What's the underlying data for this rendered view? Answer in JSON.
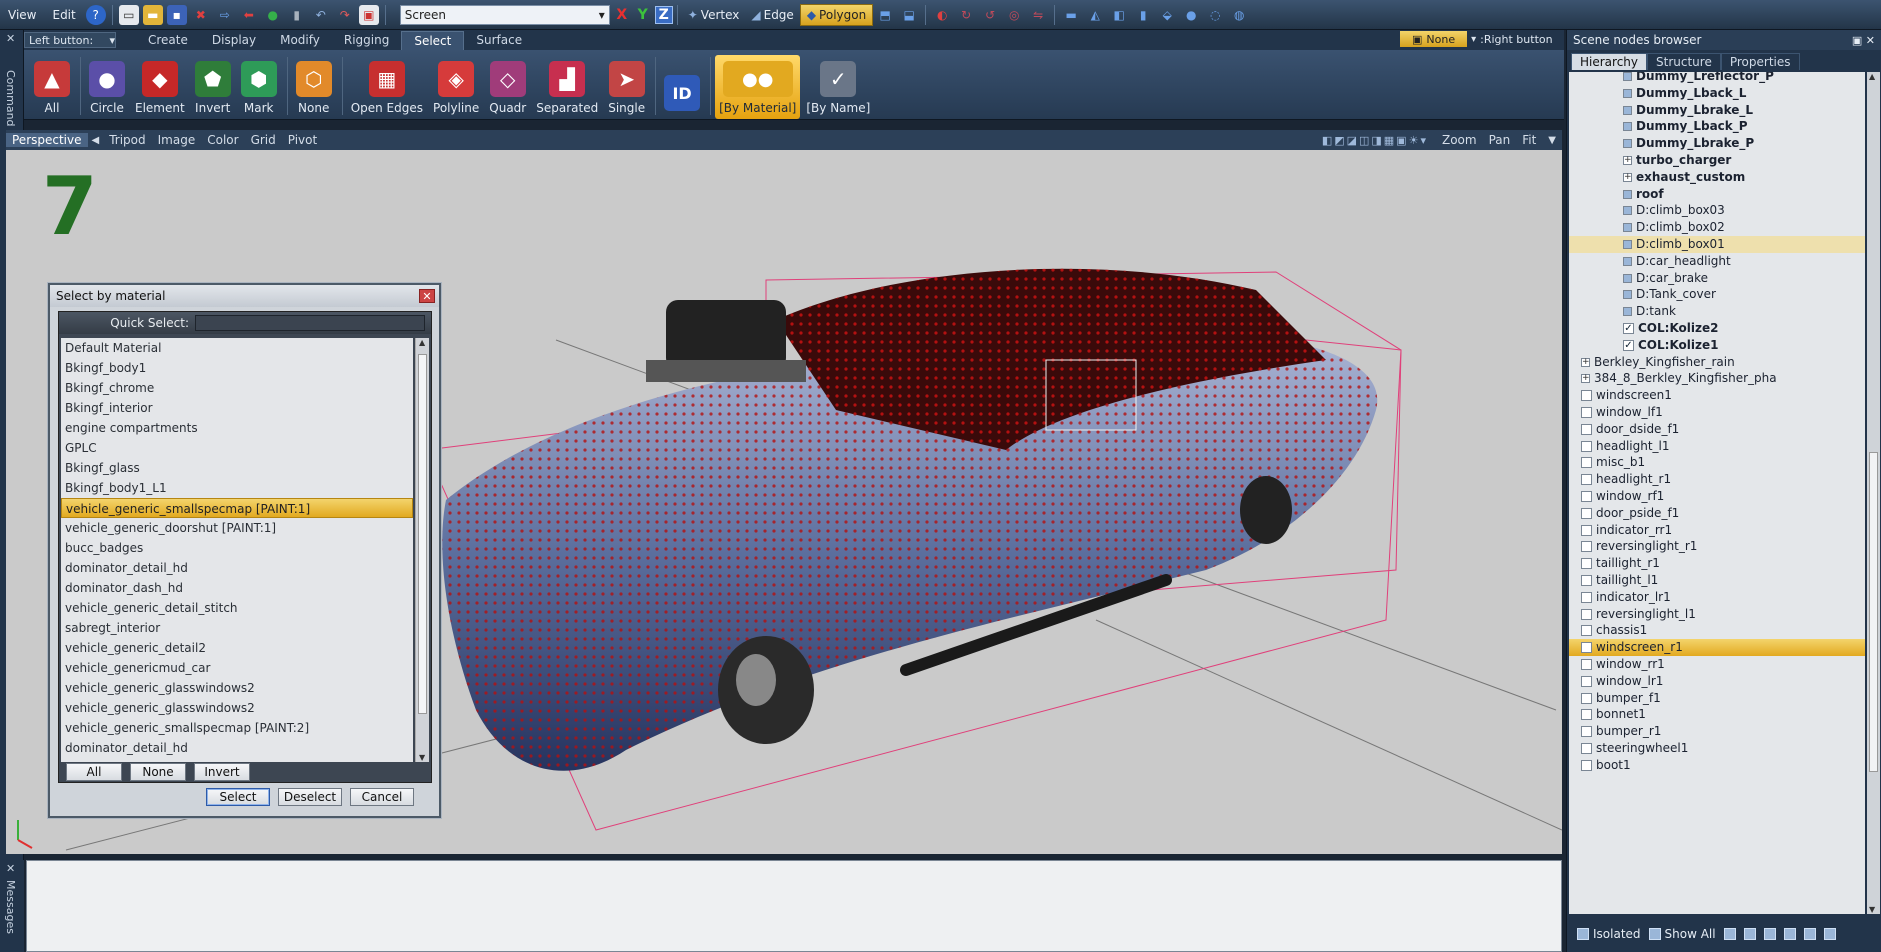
{
  "menu": {
    "view": "View",
    "edit": "Edit",
    "help_glyph": "?"
  },
  "toolbar": {
    "coord_space": "Screen",
    "axis_x": "X",
    "axis_y": "Y",
    "axis_z": "Z",
    "modes": {
      "vertex": "Vertex",
      "edge": "Edge",
      "polygon": "Polygon"
    },
    "active_mode": "Polygon"
  },
  "left_strip": {
    "command_label": "Command",
    "messages_label": "Messages"
  },
  "ribbon": {
    "left_button_label": "Left button:",
    "tabs": [
      "Create",
      "Display",
      "Modify",
      "Rigging",
      "Select",
      "Surface"
    ],
    "active_tab": "Select",
    "right_button_value": "None",
    "right_button_label": ":Right button",
    "buttons": [
      {
        "label": "All",
        "color": "#c63a3a",
        "glyph": "▲"
      },
      {
        "label": "Circle",
        "color": "#5b4fa8",
        "glyph": "●"
      },
      {
        "label": "Element",
        "color": "#c62828",
        "glyph": "◆"
      },
      {
        "label": "Invert",
        "color": "#2f7d3a",
        "glyph": "⬟"
      },
      {
        "label": "Mark",
        "color": "#2e9b58",
        "glyph": "⬢"
      },
      {
        "label": "None",
        "color": "#e28a2a",
        "glyph": "⬡"
      },
      {
        "label": "Open Edges",
        "color": "#c72f2f",
        "glyph": "▦"
      },
      {
        "label": "Polyline",
        "color": "#d63b3b",
        "glyph": "◈"
      },
      {
        "label": "Quadr",
        "color": "#a03c7a",
        "glyph": "◇"
      },
      {
        "label": "Separated",
        "color": "#c72f4f",
        "glyph": "▟"
      },
      {
        "label": "Single",
        "color": "#c24545",
        "glyph": "➤"
      },
      {
        "label": "",
        "color": "#2f5ab8",
        "glyph": "ID"
      },
      {
        "label": "[By Material]",
        "color": "#e2a920",
        "glyph": "●●"
      },
      {
        "label": "[By Name]",
        "color": "#6a7688",
        "glyph": "✓"
      }
    ],
    "active_button": "[By Material]"
  },
  "viewport": {
    "view_name": "Perspective",
    "links": [
      "Tripod",
      "Image",
      "Color",
      "Grid",
      "Pivot"
    ],
    "right_links": [
      "Zoom",
      "Pan",
      "Fit"
    ],
    "big_number": "7"
  },
  "dialog": {
    "title": "Select by material",
    "quick_select_label": "Quick Select:",
    "quick_select_value": "",
    "materials": [
      "Default Material",
      "Bkingf_body1",
      "Bkingf_chrome",
      "Bkingf_interior",
      "engine compartments",
      "GPLC",
      "Bkingf_glass",
      "Bkingf_body1_L1",
      "vehicle_generic_smallspecmap [PAINT:1]",
      "vehicle_generic_doorshut [PAINT:1]",
      "bucc_badges",
      "dominator_detail_hd",
      "dominator_dash_hd",
      "vehicle_generic_detail_stitch",
      "sabregt_interior",
      "vehicle_generic_detail2",
      "vehicle_genericmud_car",
      "vehicle_generic_glasswindows2",
      "vehicle_generic_glasswindows2",
      "vehicle_generic_smallspecmap [PAINT:2]",
      "dominator_detail_hd"
    ],
    "selected_material": "vehicle_generic_smallspecmap [PAINT:1]",
    "btn_all": "All",
    "btn_none": "None",
    "btn_invert": "Invert",
    "btn_select": "Select",
    "btn_deselect": "Deselect",
    "btn_cancel": "Cancel"
  },
  "scene_nodes": {
    "title": "Scene nodes browser",
    "tabs": [
      "Hierarchy",
      "Structure",
      "Properties"
    ],
    "active_tab": "Hierarchy",
    "nodes": [
      {
        "name": "Dummy_Lreflector_P",
        "indent": 2,
        "bold": true,
        "marker": "sq"
      },
      {
        "name": "Dummy_Lback_L",
        "indent": 2,
        "bold": true,
        "marker": "sq"
      },
      {
        "name": "Dummy_Lbrake_L",
        "indent": 2,
        "bold": true,
        "marker": "sq"
      },
      {
        "name": "Dummy_Lback_P",
        "indent": 2,
        "bold": true,
        "marker": "sq"
      },
      {
        "name": "Dummy_Lbrake_P",
        "indent": 2,
        "bold": true,
        "marker": "sq"
      },
      {
        "name": "turbo_charger",
        "indent": 2,
        "bold": true,
        "marker": "exp"
      },
      {
        "name": "exhaust_custom",
        "indent": 2,
        "bold": true,
        "marker": "exp"
      },
      {
        "name": "roof",
        "indent": 2,
        "bold": true,
        "marker": "sq"
      },
      {
        "name": "D:climb_box03",
        "indent": 2,
        "bold": false,
        "marker": "sq"
      },
      {
        "name": "D:climb_box02",
        "indent": 2,
        "bold": false,
        "marker": "sq"
      },
      {
        "name": "D:climb_box01",
        "indent": 2,
        "bold": false,
        "marker": "sq",
        "state": "hl"
      },
      {
        "name": "D:car_headlight",
        "indent": 2,
        "bold": false,
        "marker": "sq"
      },
      {
        "name": "D:car_brake",
        "indent": 2,
        "bold": false,
        "marker": "sq"
      },
      {
        "name": "D:Tank_cover",
        "indent": 2,
        "bold": false,
        "marker": "sq"
      },
      {
        "name": "D:tank",
        "indent": 2,
        "bold": false,
        "marker": "sq"
      },
      {
        "name": "COL:Kolize2",
        "indent": 2,
        "bold": true,
        "marker": "check"
      },
      {
        "name": "COL:Kolize1",
        "indent": 2,
        "bold": true,
        "marker": "check"
      },
      {
        "name": "Berkley_Kingfisher_rain",
        "indent": 1,
        "bold": false,
        "marker": "exp"
      },
      {
        "name": "384_8_Berkley_Kingfisher_pha",
        "indent": 1,
        "bold": false,
        "marker": "exp"
      },
      {
        "name": "windscreen1",
        "indent": 1,
        "bold": false,
        "marker": "cb"
      },
      {
        "name": "window_lf1",
        "indent": 1,
        "bold": false,
        "marker": "cb"
      },
      {
        "name": "door_dside_f1",
        "indent": 1,
        "bold": false,
        "marker": "cb"
      },
      {
        "name": "headlight_l1",
        "indent": 1,
        "bold": false,
        "marker": "cb"
      },
      {
        "name": "misc_b1",
        "indent": 1,
        "bold": false,
        "marker": "cb"
      },
      {
        "name": "headlight_r1",
        "indent": 1,
        "bold": false,
        "marker": "cb"
      },
      {
        "name": "window_rf1",
        "indent": 1,
        "bold": false,
        "marker": "cb"
      },
      {
        "name": "door_pside_f1",
        "indent": 1,
        "bold": false,
        "marker": "cb"
      },
      {
        "name": "indicator_rr1",
        "indent": 1,
        "bold": false,
        "marker": "cb"
      },
      {
        "name": "reversinglight_r1",
        "indent": 1,
        "bold": false,
        "marker": "cb"
      },
      {
        "name": "taillight_r1",
        "indent": 1,
        "bold": false,
        "marker": "cb"
      },
      {
        "name": "taillight_l1",
        "indent": 1,
        "bold": false,
        "marker": "cb"
      },
      {
        "name": "indicator_lr1",
        "indent": 1,
        "bold": false,
        "marker": "cb"
      },
      {
        "name": "reversinglight_l1",
        "indent": 1,
        "bold": false,
        "marker": "cb"
      },
      {
        "name": "chassis1",
        "indent": 1,
        "bold": false,
        "marker": "cb"
      },
      {
        "name": "windscreen_r1",
        "indent": 1,
        "bold": false,
        "marker": "cb",
        "state": "sel"
      },
      {
        "name": "window_rr1",
        "indent": 1,
        "bold": false,
        "marker": "cb"
      },
      {
        "name": "window_lr1",
        "indent": 1,
        "bold": false,
        "marker": "cb"
      },
      {
        "name": "bumper_f1",
        "indent": 1,
        "bold": false,
        "marker": "cb"
      },
      {
        "name": "bonnet1",
        "indent": 1,
        "bold": false,
        "marker": "cb"
      },
      {
        "name": "bumper_r1",
        "indent": 1,
        "bold": false,
        "marker": "cb"
      },
      {
        "name": "steeringwheel1",
        "indent": 1,
        "bold": false,
        "marker": "cb"
      },
      {
        "name": "boot1",
        "indent": 1,
        "bold": false,
        "marker": "cb"
      }
    ],
    "bottom": {
      "isolated": "Isolated",
      "show_all": "Show All"
    }
  }
}
